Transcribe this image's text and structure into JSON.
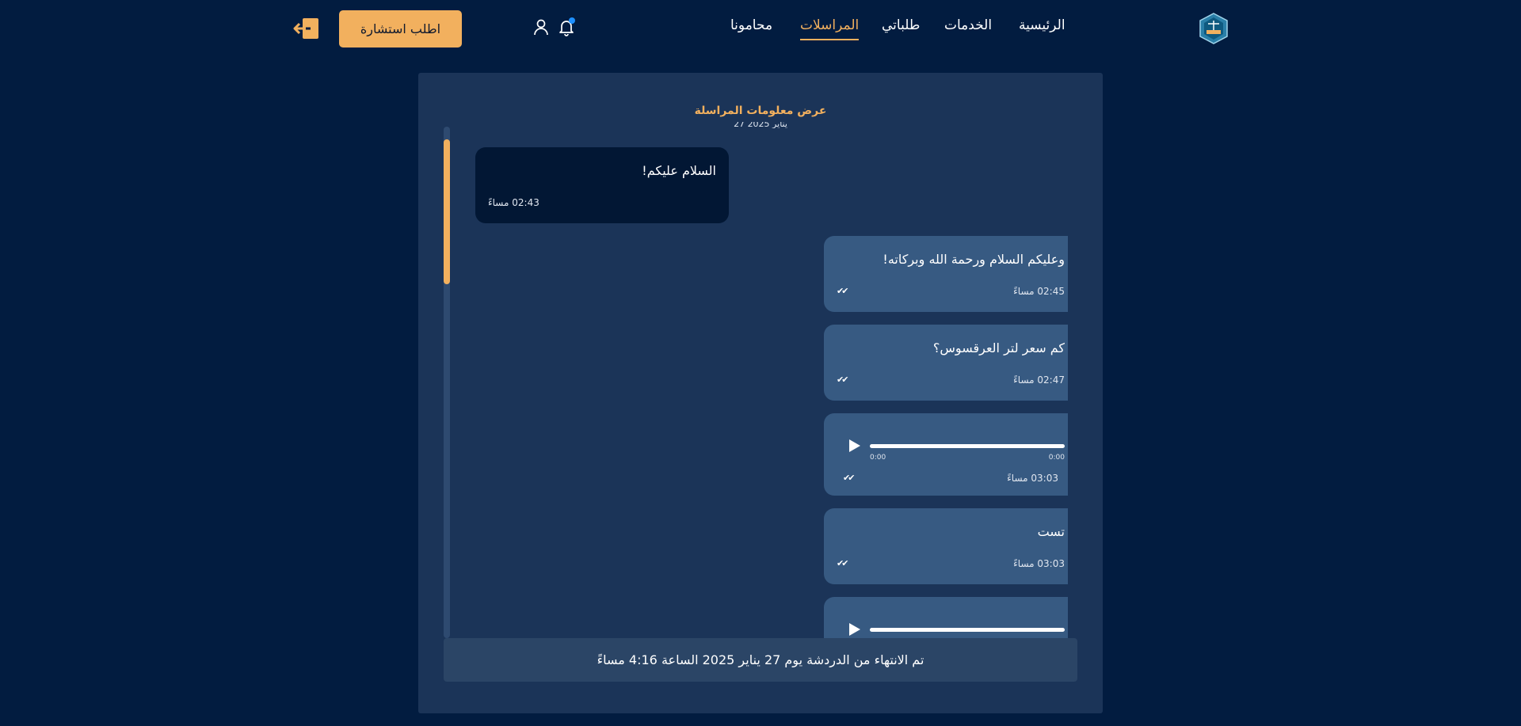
{
  "header": {
    "nav": [
      {
        "label": "الرئيسية"
      },
      {
        "label": "الخدمات"
      },
      {
        "label": "طلباتي"
      },
      {
        "label": "المراسلات"
      },
      {
        "label": "محامونا"
      }
    ],
    "active_nav": "المراسلات",
    "cta_label": "اطلب استشارة",
    "icons": [
      "logo-icon",
      "bell-icon",
      "user-icon",
      "logout-icon"
    ]
  },
  "panel": {
    "title": "عرض معلومات المراسلة",
    "date_separator": "27 يناير 2025",
    "messages": [
      {
        "direction": "incoming",
        "text": "السلام عليكم!",
        "time": "02:43 مساءً"
      },
      {
        "direction": "outgoing",
        "text": "وعليكم السلام ورحمة الله وبركاته!",
        "time": "02:45 مساءً",
        "ticks": "✔✔"
      },
      {
        "direction": "outgoing",
        "text": "كم سعر لتر العرقسوس؟",
        "time": "02:47 مساءً",
        "ticks": "✔✔"
      },
      {
        "direction": "outgoing",
        "type": "audio",
        "current": "0:00",
        "duration": "0:00",
        "time": "03:03 مساءً",
        "ticks": "✔✔"
      },
      {
        "direction": "outgoing",
        "text": "تست",
        "time": "03:03 مساءً",
        "ticks": "✔✔"
      },
      {
        "direction": "outgoing",
        "type": "audio"
      }
    ],
    "ended_notice": "تم الانتهاء من الدردشة يوم 27 يناير 2025 الساعة 4:16 مساءً"
  },
  "colors": {
    "background": "#021c40",
    "panel": "#1b3458",
    "accent": "#f2b05e",
    "outgoing_bubble": "#375a82",
    "incoming_bubble": "#021734"
  }
}
